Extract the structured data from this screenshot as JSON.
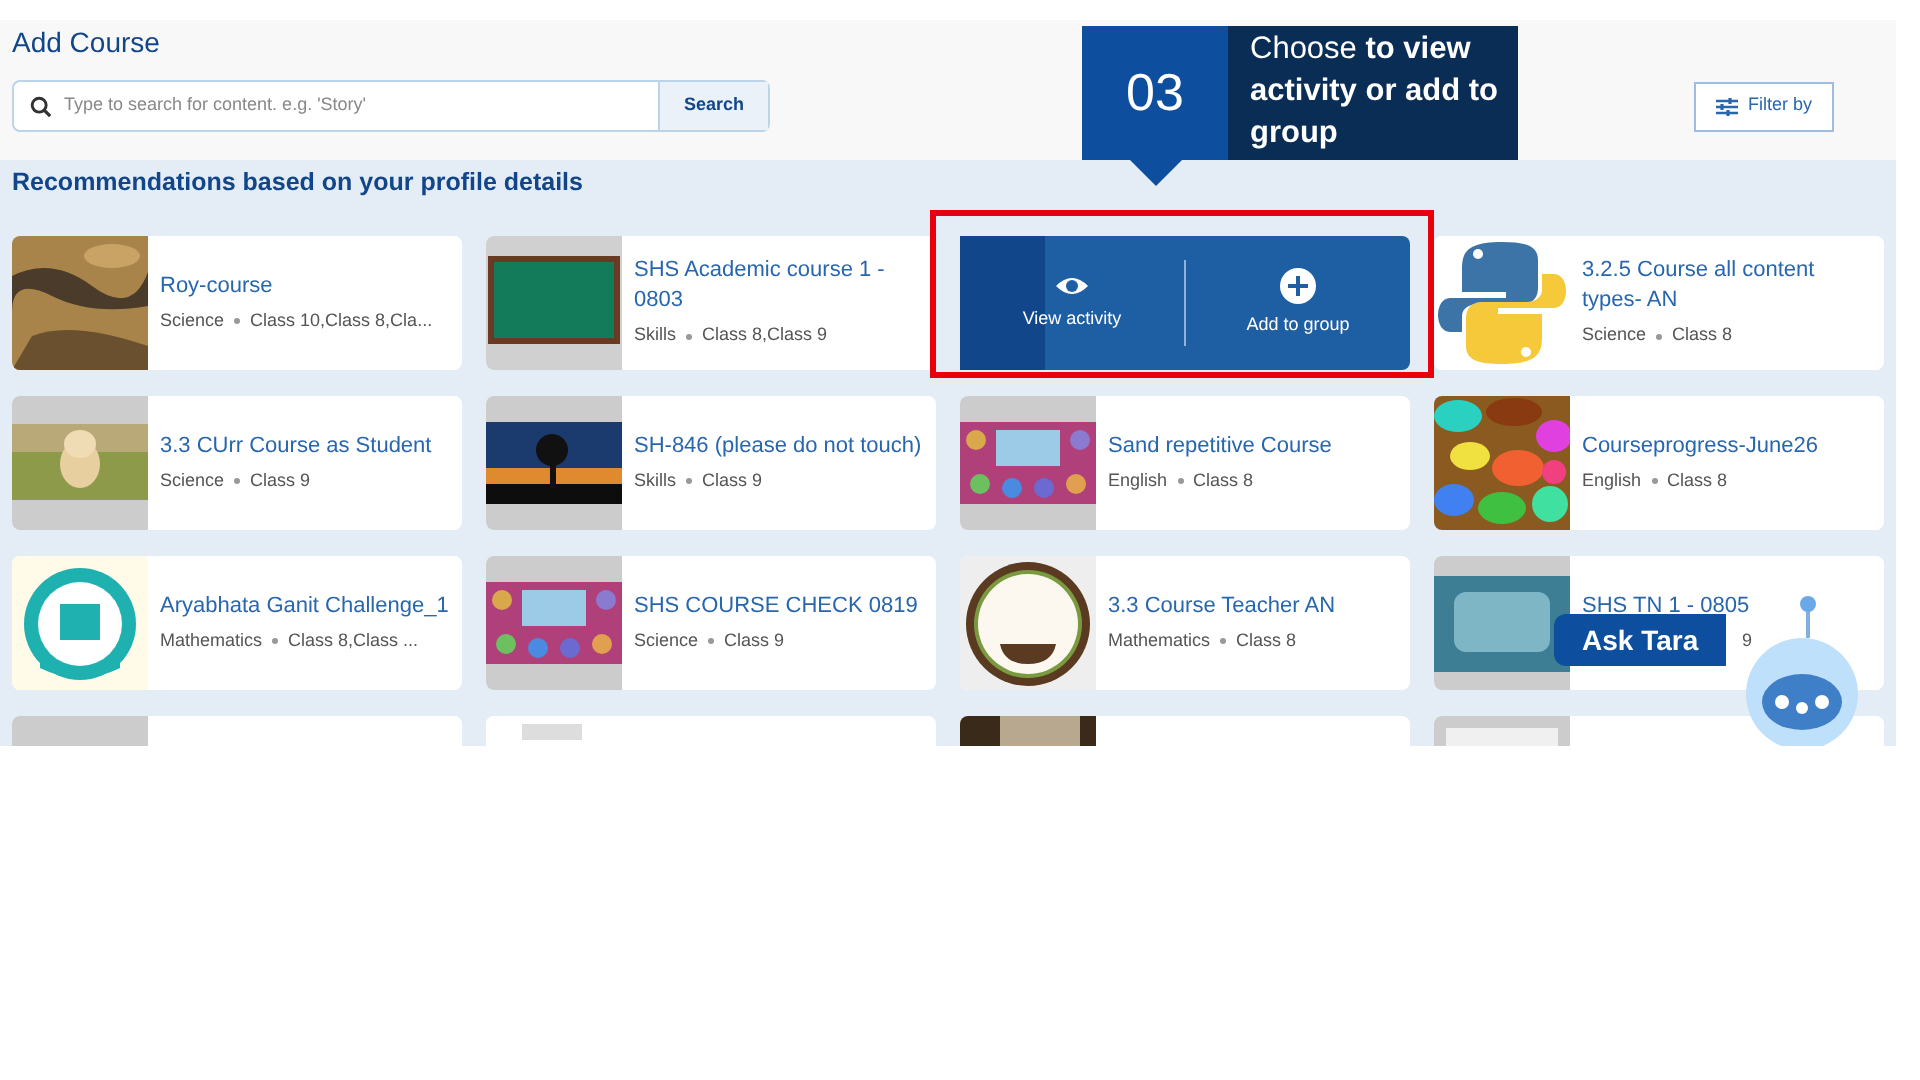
{
  "header": {
    "title": "Add Course"
  },
  "search": {
    "placeholder": "Type to search for content. e.g. 'Story'",
    "button": "Search"
  },
  "filter_button": "Filter by",
  "callout": {
    "number": "03",
    "text": "Choose **to view activity or add to group**"
  },
  "section_title": "Recommendations based on your profile details",
  "courses": [
    {
      "title": "Roy-course",
      "subject": "Science",
      "grades": "Class 10,Class 8,Cla...",
      "hovered": false
    },
    {
      "title": "SHS Academic course 1 - 0803",
      "subject": "Skills",
      "grades": "Class 8,Class 9",
      "hovered": false
    },
    {
      "hovered": true,
      "actions": [
        {
          "kind": "view",
          "label": "View activity"
        },
        {
          "kind": "add",
          "label": "Add to group"
        }
      ]
    },
    {
      "title": "3.2.5 Course all content types- AN",
      "subject": "Science",
      "grades": "Class 8",
      "hovered": false
    },
    {
      "title": "3.3 CUrr Course as Student",
      "subject": "Science",
      "grades": "Class 9",
      "hovered": false
    },
    {
      "title": "SH-846 (please do not touch)",
      "subject": "Skills",
      "grades": "Class 9",
      "hovered": false
    },
    {
      "title": "Sand repetitive Course",
      "subject": "English",
      "grades": "Class 8",
      "hovered": false
    },
    {
      "title": "Courseprogress-June26",
      "subject": "English",
      "grades": "Class 8",
      "hovered": false
    },
    {
      "title": "Aryabhata Ganit Challenge_1",
      "subject": "Mathematics",
      "grades": "Class 8,Class ...",
      "hovered": false
    },
    {
      "title": "SHS COURSE CHECK 0819",
      "subject": "Science",
      "grades": "Class 9",
      "hovered": false
    },
    {
      "title": "3.3 Course Teacher AN",
      "subject": "Mathematics",
      "grades": "Class 8",
      "hovered": false
    },
    {
      "title": "SHS TN 1 - 0805",
      "grades": "9",
      "hovered": false
    }
  ],
  "ask_tara": "Ask Tara"
}
